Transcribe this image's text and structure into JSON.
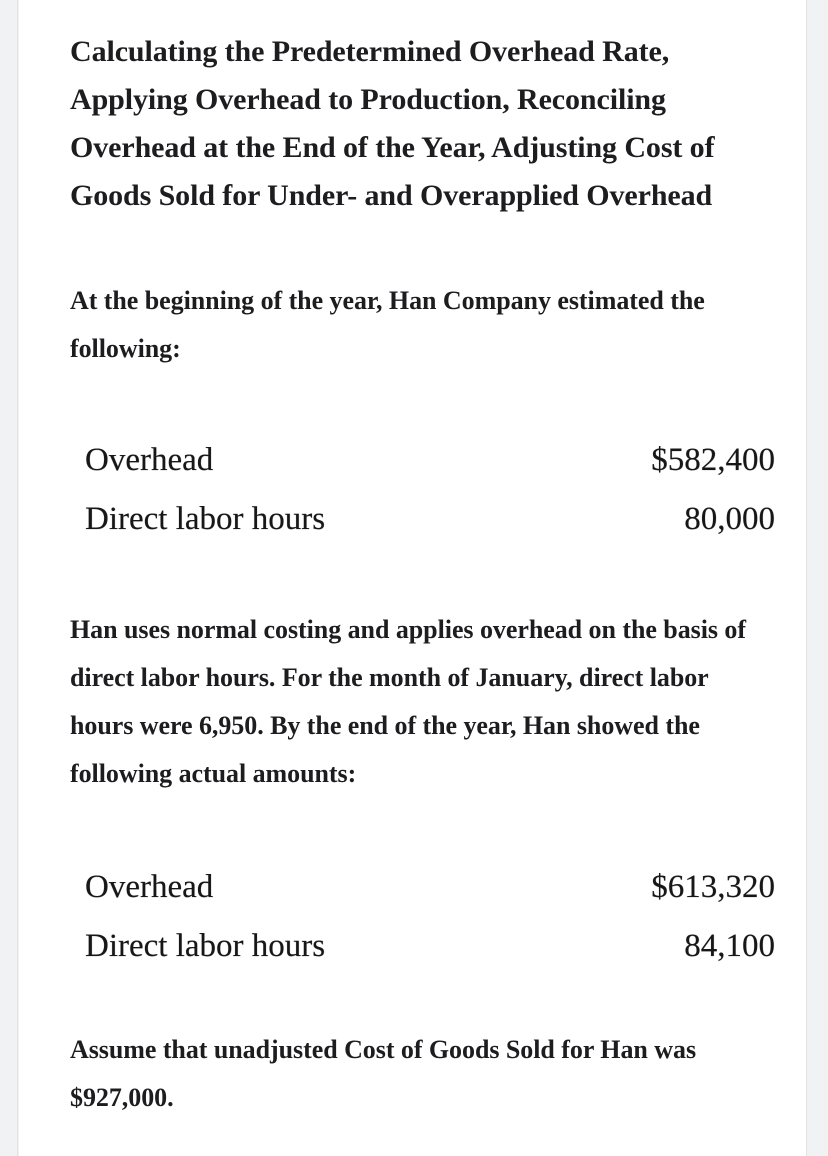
{
  "document": {
    "title": "Calculating the Predetermined Overhead Rate, Applying Overhead to Production, Reconciling Overhead at the End of the Year, Adjusting Cost of Goods Sold for Under- and Overapplied Overhead",
    "intro_paragraph": "At the beginning of the year, Han Company estimated the following:",
    "middle_paragraph": "Han uses normal costing and applies overhead on the basis of direct labor hours. For the month of January, direct labor hours were 6,950. By the end of the year, Han showed the following actual amounts:",
    "closing_paragraph": "Assume that unadjusted Cost of Goods Sold for Han was $927,000."
  },
  "estimated_table": {
    "rows": [
      {
        "label": "Overhead",
        "value": "$582,400"
      },
      {
        "label": "Direct labor hours",
        "value": "80,000"
      }
    ]
  },
  "actual_table": {
    "rows": [
      {
        "label": "Overhead",
        "value": "$613,320"
      },
      {
        "label": "Direct labor hours",
        "value": "84,100"
      }
    ]
  },
  "theme": {
    "page_background": "#f1f2f4",
    "sheet_background": "#ffffff",
    "text_color": "#1d1d20",
    "rule_color": "#e2e3e5"
  }
}
